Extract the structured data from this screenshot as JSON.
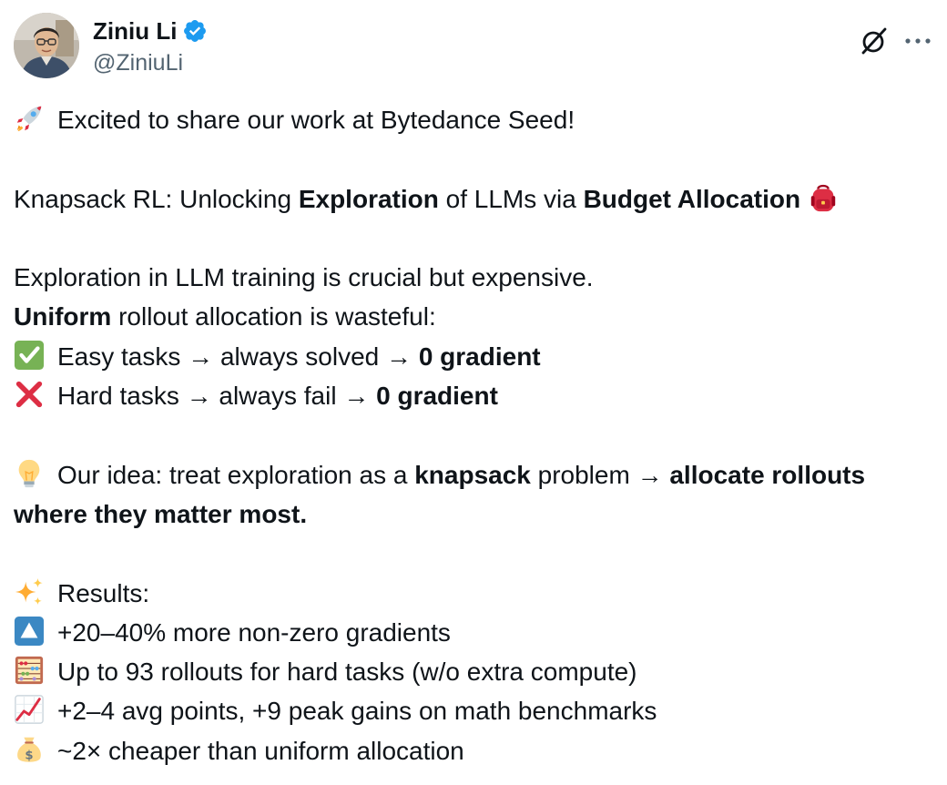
{
  "author": {
    "display_name": "Ziniu Li",
    "handle": "@ZiniuLi",
    "verified": true,
    "avatar_icon": "user-avatar-photo"
  },
  "header_actions": {
    "grok_icon": "grok-slash-icon",
    "more_icon": "ellipsis-icon"
  },
  "tweet": {
    "l1_text": "Excited to share our work at Bytedance Seed!",
    "l2_a": "Knapsack RL: Unlocking ",
    "l2_b": "Exploration",
    "l2_c": " of LLMs via ",
    "l2_d": "Budget Allocation",
    "l3_text": "Exploration in LLM training is crucial but expensive.",
    "l4_a": "Uniform",
    "l4_b": " rollout allocation is wasteful:",
    "l5_a": "Easy tasks → always solved → ",
    "l5_b": "0 gradient",
    "l6_a": "Hard tasks → always fail → ",
    "l6_b": "0 gradient",
    "l7_a": "Our idea: treat exploration as a ",
    "l7_b": "knapsack",
    "l7_c": " problem → ",
    "l7_d": "allocate rollouts where they matter most.",
    "l8_text": "Results:",
    "l9_text": "+20–40% more non-zero gradients",
    "l10_text": "Up to 93 rollouts for hard tasks (w/o extra compute)",
    "l11_text": "+2–4 avg points, +9 peak gains on math benchmarks",
    "l12_text": "~2× cheaper than uniform allocation"
  },
  "emoji_icons": [
    "rocket-icon",
    "backpack-icon",
    "check-mark-icon",
    "cross-mark-icon",
    "light-bulb-icon",
    "sparkles-icon",
    "up-triangle-icon",
    "abacus-icon",
    "chart-increasing-icon",
    "money-bag-icon"
  ],
  "colors": {
    "text": "#0f1419",
    "secondary": "#536471",
    "verified_blue": "#1d9bf0"
  }
}
